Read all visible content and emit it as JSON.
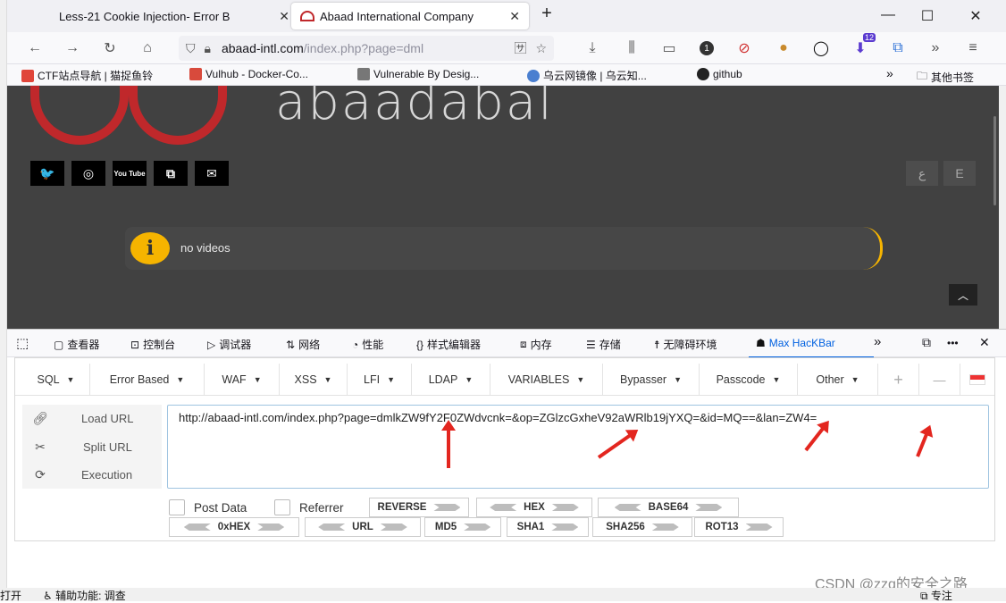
{
  "tabs": [
    {
      "label": "Less-21 Cookie Injection- Error B",
      "close": "✕",
      "active": false
    },
    {
      "label": "Abaad International Company",
      "close": "✕",
      "active": true
    }
  ],
  "new_tab": "+",
  "window_controls": {
    "minimize": "—",
    "maximize": "☐",
    "close": "✕"
  },
  "urlbar": {
    "host": "abaad-intl.com",
    "path": "/index.php?page=dml"
  },
  "bookmarks": [
    {
      "label": "CTF站点导航 | 猫捉鱼铃",
      "icon_color": "#e0453a"
    },
    {
      "label": "Vulhub - Docker-Co...",
      "icon_color": "#d84a3c"
    },
    {
      "label": "Vulnerable By Desig...",
      "icon_color": "#777777"
    },
    {
      "label": "乌云网镜像 | 乌云知...",
      "icon_color": "#4a7fd0"
    },
    {
      "label": "github",
      "icon_color": "#222222"
    }
  ],
  "bookmarks_overflow": "»",
  "other_bookmarks": "其他书签",
  "nav_badges": {
    "notification_count": "1",
    "download_count": "12"
  },
  "page": {
    "logo_text": "abaadabal",
    "lang_buttons": [
      "ع",
      "E"
    ],
    "notice_icon": "i",
    "notice_text": "no videos",
    "to_top": "︿"
  },
  "social_icons": [
    "twitter-icon",
    "instagram-icon",
    "youtube-icon",
    "pdf-icon",
    "mail-icon"
  ],
  "social_glyphs": [
    "🐦",
    "◎",
    "You Tube",
    "⧉",
    "✉"
  ],
  "devtools": {
    "tabs": [
      "查看器",
      "控制台",
      "调试器",
      "网络",
      "性能",
      "样式编辑器",
      "内存",
      "存储",
      "无障碍环境",
      "Max HacKBar"
    ],
    "active_tab": "Max HacKBar",
    "overflow": "»",
    "more": "•••",
    "close": "✕"
  },
  "hackbar": {
    "menus": [
      "SQL",
      "Error Based",
      "WAF",
      "XSS",
      "LFI",
      "LDAP",
      "VARIABLES",
      "Bypasser",
      "Passcode",
      "Other"
    ],
    "plus": "+",
    "minus": "—",
    "actions": [
      "Load URL",
      "Split URL",
      "Execution"
    ],
    "url_value": "http://abaad-intl.com/index.php?page=dmlkZW9fY2F0ZWdvcnk=&op=ZGlzcGxheV92aWRlb19jYXQ=&id=MQ==&lan=ZW4=",
    "checkboxes": [
      "Post Data",
      "Referrer"
    ],
    "row1_buttons": [
      "REVERSE",
      "HEX",
      "BASE64"
    ],
    "row2_buttons": [
      "0xHEX",
      "URL",
      "MD5",
      "SHA1",
      "SHA256",
      "ROT13"
    ]
  },
  "status": {
    "left": "打开",
    "accessibility": "辅助功能: 调查",
    "right": "专注"
  },
  "watermark": "CSDN @zzq的安全之路"
}
